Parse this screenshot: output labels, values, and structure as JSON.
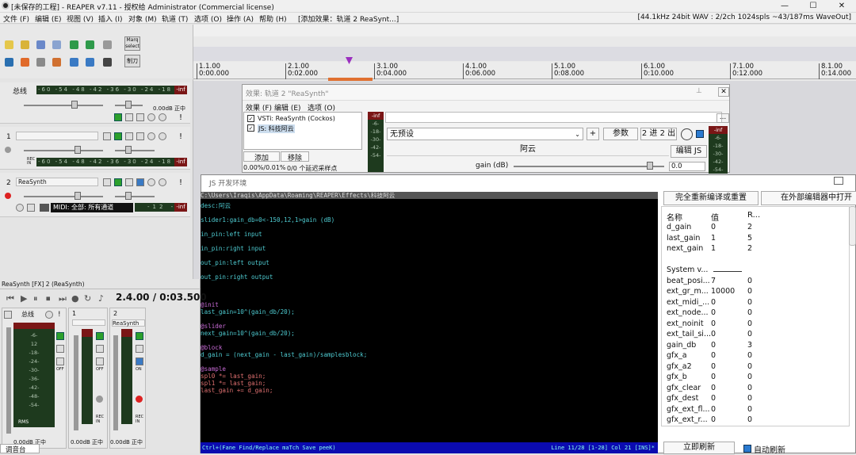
{
  "window": {
    "title": "[未保存的工程] - REAPER v7.11 - 授权给 Administrator (Commercial license)",
    "controls": [
      "—",
      "☐",
      "✕"
    ]
  },
  "menu": {
    "items": [
      "文件 (F)",
      "编辑 (E)",
      "视图 (V)",
      "插入 (I)",
      "对象 (M)",
      "轨道 (T)",
      "选项 (O)",
      "操作 (A)",
      "帮助 (H)",
      "[添加效果：轨道 2 ReaSynt...]"
    ],
    "status": "[44.1kHz 24bit WAV : 2/2ch 1024spls ~43/187ms WaveOut]"
  },
  "toolbar": {
    "marq_label": "Marq select",
    "draw_label": "制刀"
  },
  "ruler": {
    "marks": [
      {
        "bar": "1.1.00",
        "time": "0:00.000"
      },
      {
        "bar": "2.1.00",
        "time": "0:02.000"
      },
      {
        "bar": "3.1.00",
        "time": "0:04.000"
      },
      {
        "bar": "4.1.00",
        "time": "0:06.000"
      },
      {
        "bar": "5.1.00",
        "time": "0:08.000"
      },
      {
        "bar": "6.1.00",
        "time": "0:10.000"
      },
      {
        "bar": "7.1.00",
        "time": "0:12.000"
      },
      {
        "bar": "8.1.00",
        "time": "0:14.000"
      }
    ]
  },
  "tracks": {
    "master": {
      "name": "总线",
      "meter_scale": "-60 -54 -48 -42 -36 -30 -24 -18 -12 -6",
      "clip": "-inf",
      "volume": "0.00dB 正中"
    },
    "t1": {
      "num": "1",
      "meter_scale": "-60 -54 -48 -42 -36 -30 -24 -18 -12 -6",
      "clip": "-inf",
      "rec_in": "REC IN"
    },
    "t2": {
      "num": "2",
      "name": "ReaSynth",
      "midi": "MIDI: 全部: 所有通道",
      "meter_scale": "-12 -6",
      "clip": "-inf"
    }
  },
  "fx_chain": {
    "title": "效果: 轨道 2 \"ReaSynth\"",
    "menu": [
      "效果 (F)",
      "编辑 (E)",
      "选项 (O)"
    ],
    "plugins": [
      "VSTi: ReaSynth (Cockos)",
      "JS: 科技阿云"
    ],
    "add": "添加",
    "remove": "移除",
    "cpu": "0.00%/0.01%",
    "latency": "0/0 个延迟采样点",
    "preset": "无预设",
    "plus": "+",
    "params": "参数",
    "io": "2 进 2 出",
    "plugin_name": "阿云",
    "edit_js": "编辑 JS",
    "slider_label": "gain (dB)",
    "slider_value": "0.0",
    "meter_scale": [
      "-inf",
      "-6-",
      "-18-",
      "-30-",
      "-42-",
      "-54-"
    ],
    "browse": "..."
  },
  "js_editor": {
    "title": "JS 开发环境",
    "path": "C:\\Users\\Iraqis\\AppData\\Roaming\\REAPER\\Effects\\科技阿云",
    "lines": [
      "desc:阿云",
      "",
      "slider1:gain_db=0<-150,12,1>gain (dB)",
      "",
      "in_pin:left input",
      "",
      "in_pin:right input",
      "",
      "out_pin:left output",
      "",
      "out_pin:right output",
      "",
      "",
      "",
      "@init",
      "last_gain=10^(gain_db/20);",
      "",
      "@slider",
      "next_gain=10^(gain_db/20);",
      "",
      "@block",
      "d_gain = (next_gain - last_gain)/samplesblock;",
      "",
      "@sample",
      "spl0 *= last_gain;",
      "spl1 *= last_gain;",
      "last_gain += d_gain;"
    ],
    "status_left": "Ctrl+(Fane Find/Replace maTch Save peeK)",
    "status_right": "Line 11/28 [1-28]  Col 21 [INS]*",
    "recompile": "完全重新编译或重置",
    "open_external": "在外部编辑器中打开",
    "refresh_now": "立即刷新",
    "auto_refresh": "自动刷新",
    "var_headers": [
      "名称",
      "值",
      "R..."
    ],
    "vars": [
      [
        "d_gain",
        "0",
        "2"
      ],
      [
        "last_gain",
        "1",
        "5"
      ],
      [
        "next_gain",
        "1",
        "2"
      ],
      [
        "",
        "",
        ""
      ],
      [
        "System v...",
        "",
        ""
      ],
      [
        "beat_posi...",
        "7",
        "0"
      ],
      [
        "ext_gr_m...",
        "10000",
        "0"
      ],
      [
        "ext_midi_...",
        "0",
        "0"
      ],
      [
        "ext_node...",
        "0",
        "0"
      ],
      [
        "ext_noinit",
        "0",
        "0"
      ],
      [
        "ext_tail_si...",
        "0",
        "0"
      ],
      [
        "gain_db",
        "0",
        "3"
      ],
      [
        "gfx_a",
        "0",
        "0"
      ],
      [
        "gfx_a2",
        "0",
        "0"
      ],
      [
        "gfx_b",
        "0",
        "0"
      ],
      [
        "gfx_clear",
        "0",
        "0"
      ],
      [
        "gfx_dest",
        "0",
        "0"
      ],
      [
        "gfx_ext_fl...",
        "0",
        "0"
      ],
      [
        "gfx_ext_r...",
        "0",
        "0"
      ]
    ]
  },
  "mixer": {
    "caption": "ReaSynth [FX] 2 (ReaSynth)",
    "time": "2.4.00 / 0:03.500",
    "strip_names": [
      "总线",
      "1",
      "2"
    ],
    "strip2_label": "ReaSynth",
    "vol": "0.00dB 正中",
    "rms": "RMS",
    "off": "OFF",
    "on": "ON",
    "rec_in": "REC IN",
    "tab": "调音台",
    "master_scale": [
      "-inf",
      "-6-",
      "12",
      "-18-",
      "-24-",
      "-30-",
      "-36-",
      "-42-",
      "-48-",
      "-54-"
    ],
    "colors": {
      "accent": "#9b2fbf",
      "meter_bg": "#1e3a1e",
      "clip": "#7a1616"
    }
  }
}
